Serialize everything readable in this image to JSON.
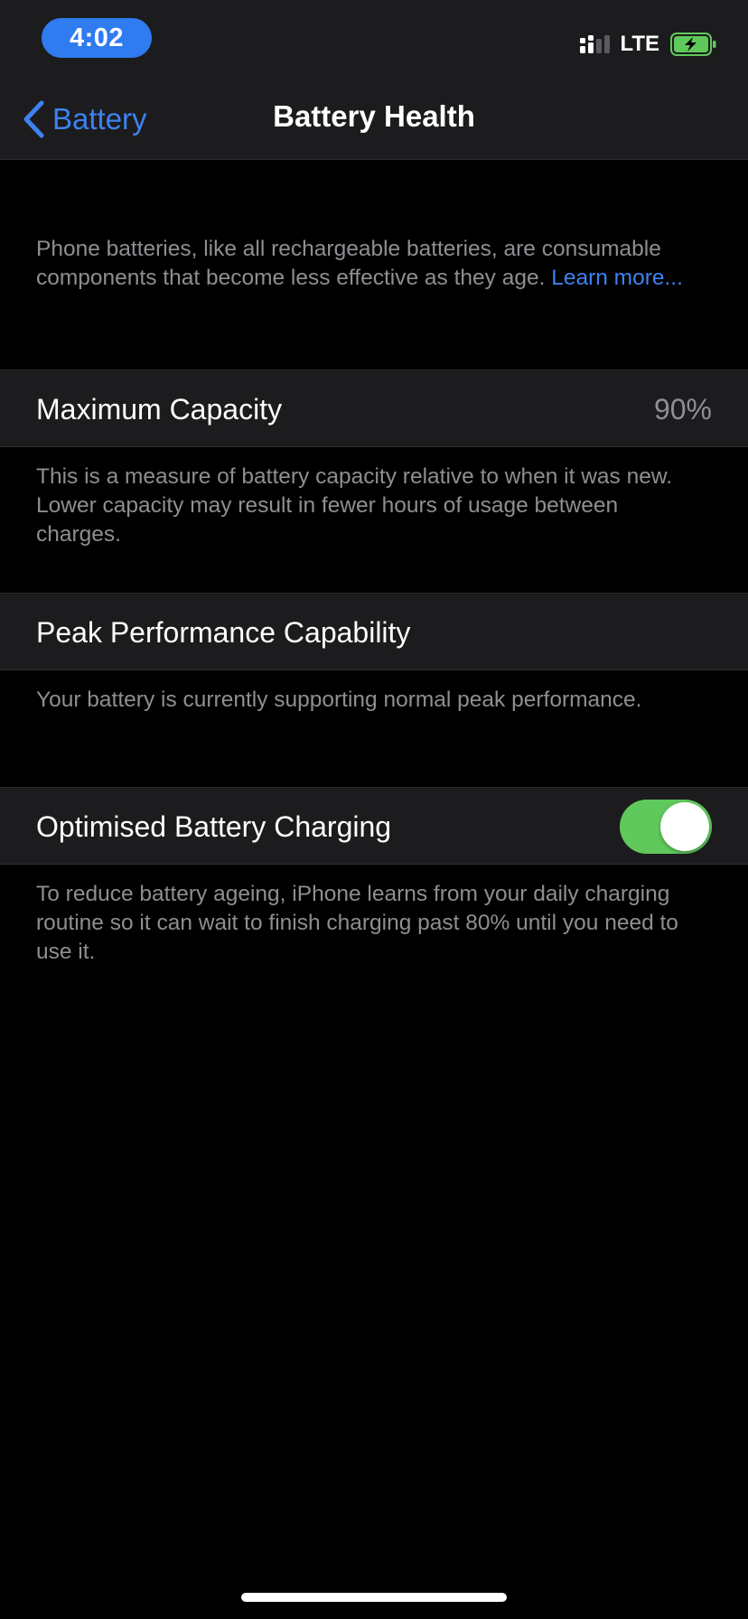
{
  "status_bar": {
    "time": "4:02",
    "network": "LTE",
    "accent_color": "#2f7bf0",
    "battery_color": "#5fc95b"
  },
  "nav": {
    "back_label": "Battery",
    "title": "Battery Health"
  },
  "intro": {
    "text": "Phone batteries, like all rechargeable batteries, are consumable components that become less effective as they age. ",
    "link": "Learn more..."
  },
  "max_capacity": {
    "label": "Maximum Capacity",
    "value": "90%",
    "description": "This is a measure of battery capacity relative to when it was new. Lower capacity may result in fewer hours of usage between charges."
  },
  "peak_performance": {
    "label": "Peak Performance Capability",
    "description": "Your battery is currently supporting normal peak performance."
  },
  "optimised_charging": {
    "label": "Optimised Battery Charging",
    "enabled": true,
    "description": "To reduce battery ageing, iPhone learns from your daily charging routine so it can wait to finish charging past 80% until you need to use it."
  }
}
